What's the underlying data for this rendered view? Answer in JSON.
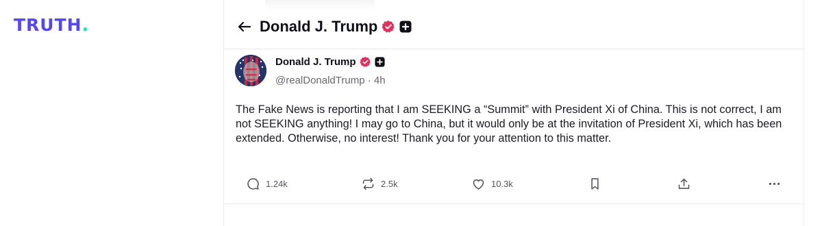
{
  "brand": {
    "logo_text": "TRUTH",
    "logo_dot": ".",
    "color": "#5448ee",
    "dot_color": "#17e2b6"
  },
  "header": {
    "title": "Donald J. Trump"
  },
  "post": {
    "author_name": "Donald J. Trump",
    "handle": "@realDonaldTrump",
    "separator": "·",
    "time": "4h",
    "text": "The Fake News is reporting that I am SEEKING a “Summit” with President Xi of China. This is not correct, I am not SEEKING anything! I may go to China, but it would only be at the invitation of President Xi, which has been extended. Otherwise, no interest! Thank you for your attention to this matter.",
    "actions": {
      "replies": "1.24k",
      "retruths": "2.5k",
      "likes": "10.3k"
    }
  },
  "colors": {
    "verified": "#e0305d",
    "text": "#0f0f1a",
    "muted": "#666674",
    "border": "#e9e9ee"
  },
  "icons": [
    "arrow-left-icon",
    "verified-icon",
    "plus-badge-icon",
    "reply-icon",
    "retruth-icon",
    "heart-icon",
    "bookmark-icon",
    "share-icon",
    "more-icon"
  ]
}
